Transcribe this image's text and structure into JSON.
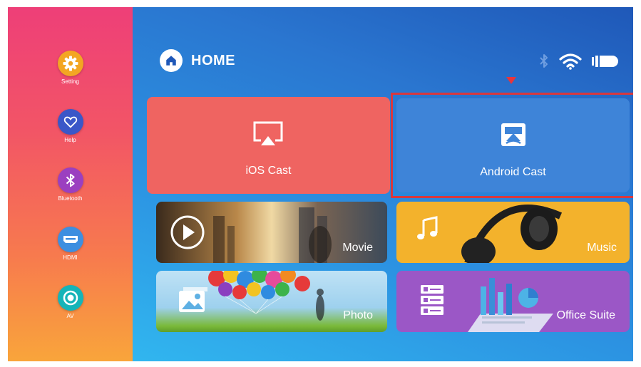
{
  "sidebar": {
    "items": [
      {
        "label": "Setting",
        "icon": "gear-icon",
        "color": "#f3a623"
      },
      {
        "label": "Help",
        "icon": "heart-icon",
        "color": "#3a57c8"
      },
      {
        "label": "Bluetooth",
        "icon": "bluetooth-icon",
        "color": "#9b3fc0"
      },
      {
        "label": "HDMI",
        "icon": "hdmi-icon",
        "color": "#3d8fe0"
      },
      {
        "label": "AV",
        "icon": "av-icon",
        "color": "#15b4b8"
      }
    ]
  },
  "header": {
    "title": "HOME",
    "status_icons": [
      "bluetooth-icon",
      "wifi-icon",
      "battery-icon"
    ]
  },
  "tiles": {
    "ios_cast": {
      "label": "iOS Cast",
      "icon": "airplay-icon",
      "color": "#ef6461"
    },
    "android_cast": {
      "label": "Android Cast",
      "icon": "screencast-icon",
      "color": "#3e84d8",
      "selected": true
    },
    "movie": {
      "label": "Movie",
      "icon": "play-icon"
    },
    "music": {
      "label": "Music",
      "icon": "music-note-icon",
      "color": "#f3b22c"
    },
    "photo": {
      "label": "Photo",
      "icon": "image-icon"
    },
    "office": {
      "label": "Office Suite",
      "icon": "document-list-icon",
      "color": "#9b57c6"
    }
  },
  "colors": {
    "sidebar_gradient": [
      "#ee3f78",
      "#f9a53b"
    ],
    "main_gradient": [
      "#1f58b8",
      "#31b6ef"
    ],
    "highlight": "#d8383e"
  }
}
